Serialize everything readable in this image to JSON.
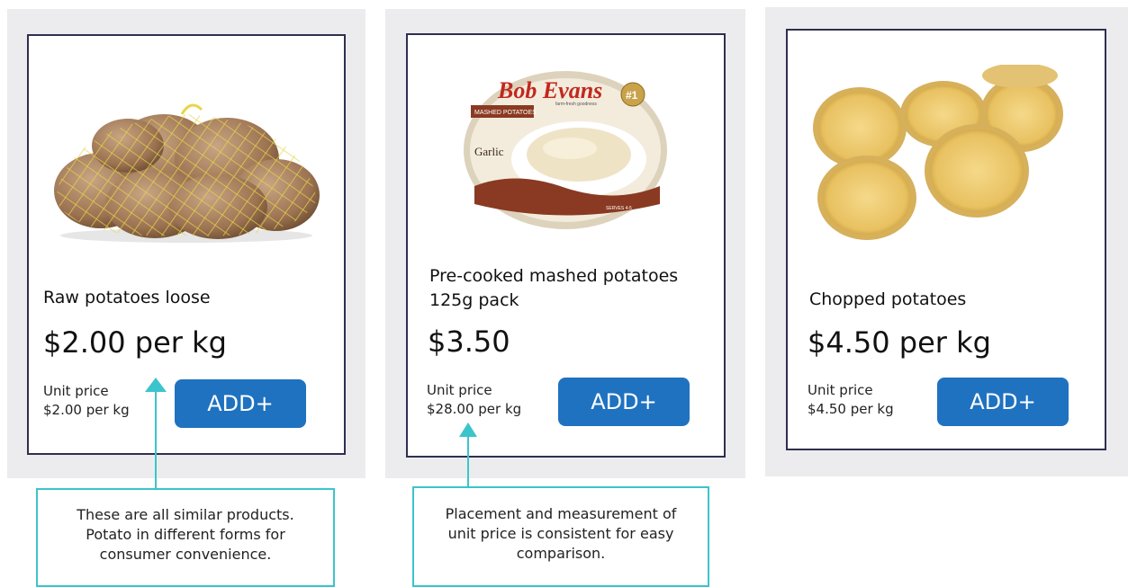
{
  "products": [
    {
      "name": "Raw potatoes loose",
      "price": "$2.00 per kg",
      "unit_label": "Unit price",
      "unit_value": "$2.00 per kg",
      "add_label": "ADD+",
      "image_icon": "potato-net-bag-image"
    },
    {
      "name_line1": "Pre-cooked mashed potatoes",
      "name_line2": "125g pack",
      "price": "$3.50",
      "unit_label": "Unit price",
      "unit_value": "$28.00 per kg",
      "add_label": "ADD+",
      "image_icon": "mashed-potato-tub-image",
      "package": {
        "brand": "Bob Evans",
        "tagline": "farm-fresh goodness",
        "badge": "#1",
        "band": "MASHED POTATOES",
        "flavor": "Garlic",
        "serves": "SERVES 4-5"
      }
    },
    {
      "name": "Chopped potatoes",
      "price": "$4.50 per kg",
      "unit_label": "Unit price",
      "unit_value": "$4.50 per kg",
      "add_label": "ADD+",
      "image_icon": "halved-potatoes-image"
    }
  ],
  "callouts": [
    {
      "lines": [
        "These are all similar products.",
        "Potato in different forms for",
        "consumer convenience."
      ]
    },
    {
      "lines": [
        "Placement and measurement of",
        "unit price is consistent for easy",
        "comparison."
      ]
    }
  ],
  "colors": {
    "add_button": "#1f72c0",
    "callout_line": "#3cc4cc",
    "card_border": "#2f2f4f",
    "panel": "#ececef"
  }
}
